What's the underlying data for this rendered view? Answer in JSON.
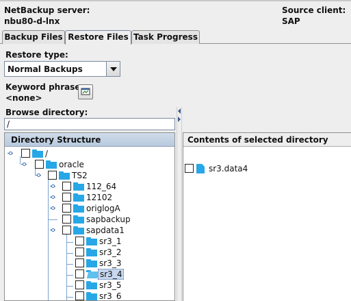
{
  "header": {
    "server_label": "NetBackup server:",
    "server_value": "nbu80-d-lnx",
    "client_label": "Source client:",
    "client_value": "SAP"
  },
  "tabs": [
    {
      "label": "Backup Files",
      "active": false
    },
    {
      "label": "Restore Files",
      "active": true
    },
    {
      "label": "Task Progress",
      "active": false
    }
  ],
  "restore_type": {
    "label": "Restore type:",
    "value": "Normal Backups"
  },
  "keyword": {
    "label": "Keyword phrase:",
    "value": "<none>"
  },
  "browse": {
    "label": "Browse directory:",
    "value": "/"
  },
  "tree": {
    "header": "Directory Structure",
    "nodes": [
      {
        "label": "/",
        "selected": false
      },
      {
        "label": "oracle",
        "selected": false
      },
      {
        "label": "TS2",
        "selected": false
      },
      {
        "label": "112_64",
        "selected": false
      },
      {
        "label": "12102",
        "selected": false
      },
      {
        "label": "origlogA",
        "selected": false
      },
      {
        "label": "sapbackup",
        "selected": false
      },
      {
        "label": "sapdata1",
        "selected": false
      },
      {
        "label": "sr3_1",
        "selected": false
      },
      {
        "label": "sr3_2",
        "selected": false
      },
      {
        "label": "sr3_3",
        "selected": false
      },
      {
        "label": "sr3_4",
        "selected": true
      },
      {
        "label": "sr3_5",
        "selected": false
      },
      {
        "label": "sr3_6",
        "selected": false
      }
    ]
  },
  "contents": {
    "header": "Contents of selected directory",
    "items": [
      {
        "label": "sr3.data4"
      }
    ]
  },
  "colors": {
    "folder": "#27a7e6",
    "header_gradient": "#b8cadf",
    "selection": "#c6d7ee"
  }
}
